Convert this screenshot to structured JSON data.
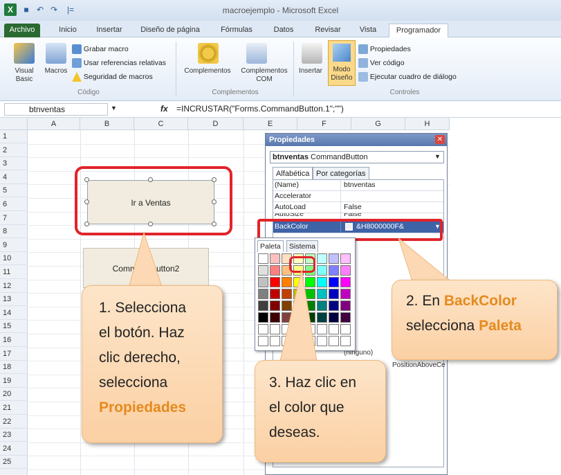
{
  "window": {
    "title": "macroejemplo - Microsoft Excel"
  },
  "quick_access": {
    "excel_logo": "X",
    "save": "■",
    "undo": "↶",
    "redo": "↷",
    "customize": "|="
  },
  "tabs": [
    "Archivo",
    "Inicio",
    "Insertar",
    "Diseño de página",
    "Fórmulas",
    "Datos",
    "Revisar",
    "Vista",
    "Programador"
  ],
  "ribbon": {
    "codigo": {
      "visual_basic": "Visual Basic",
      "macros": "Macros",
      "grabar": "Grabar macro",
      "referencias": "Usar referencias relativas",
      "seguridad": "Seguridad de macros",
      "group": "Código"
    },
    "complementos": {
      "complementos": "Complementos",
      "com": "Complementos COM",
      "group": "Complementos"
    },
    "controles": {
      "insertar": "Insertar",
      "modo_diseno": "Modo Diseño",
      "propiedades": "Propiedades",
      "ver_codigo": "Ver código",
      "ejecutar": "Ejecutar cuadro de diálogo",
      "group": "Controles"
    }
  },
  "formula_bar": {
    "name_box": "btnventas",
    "fx": "fx",
    "formula": "=INCRUSTAR(\"Forms.CommandButton.1\";\"\")"
  },
  "columns": [
    "A",
    "B",
    "C",
    "D",
    "E",
    "F",
    "G",
    "H"
  ],
  "rows": [
    "1",
    "2",
    "3",
    "4",
    "5",
    "6",
    "7",
    "8",
    "9",
    "10",
    "11",
    "12",
    "13",
    "14",
    "15",
    "16",
    "17",
    "18",
    "19",
    "20",
    "21",
    "22",
    "23",
    "24",
    "25"
  ],
  "buttons": {
    "btn1": "Ir a Ventas",
    "btn2": "CommandButton2"
  },
  "properties_window": {
    "title": "Propiedades",
    "object_name": "btnventas",
    "object_type": "CommandButton",
    "tabs": [
      "Alfabética",
      "Por categorías"
    ],
    "rows": [
      {
        "name": "(Name)",
        "value": "btnventas"
      },
      {
        "name": "Accelerator",
        "value": ""
      },
      {
        "name": "AutoLoad",
        "value": "False"
      },
      {
        "name": "AutoSize",
        "value": "False"
      },
      {
        "name": "BackColor",
        "value": "&H8000000F&"
      }
    ],
    "lower_rows": [
      {
        "name": "",
        "value": "(ninguno)"
      },
      {
        "name": "",
        "value": "PositionAboveCe"
      }
    ]
  },
  "palette": {
    "tabs": [
      "Paleta",
      "Sistema"
    ],
    "colors": [
      [
        "#ffffff",
        "#ffc0c0",
        "#ffe0c0",
        "#ffffc0",
        "#c0ffc0",
        "#c0ffff",
        "#c0c0ff",
        "#ffc0ff"
      ],
      [
        "#e0e0e0",
        "#ff8080",
        "#ffc080",
        "#ffff80",
        "#80ff80",
        "#80ffff",
        "#8080ff",
        "#ff80ff"
      ],
      [
        "#c0c0c0",
        "#ff0000",
        "#ff8000",
        "#ffff00",
        "#00ff00",
        "#00ffff",
        "#0000ff",
        "#ff00ff"
      ],
      [
        "#808080",
        "#c00000",
        "#c04000",
        "#c0c000",
        "#00c000",
        "#00c0c0",
        "#0000c0",
        "#c000c0"
      ],
      [
        "#404040",
        "#800000",
        "#804000",
        "#808000",
        "#008000",
        "#008080",
        "#000080",
        "#800080"
      ],
      [
        "#000000",
        "#400000",
        "#804040",
        "#404000",
        "#004000",
        "#004040",
        "#000040",
        "#400040"
      ],
      [
        "#ffffff",
        "#ffffff",
        "#ffffff",
        "#ffffff",
        "#ffffff",
        "#ffffff",
        "#ffffff",
        "#ffffff"
      ],
      [
        "#ffffff",
        "#ffffff",
        "#ffffff",
        "#ffffff",
        "#ffffff",
        "#ffffff",
        "#ffffff",
        "#ffffff"
      ]
    ]
  },
  "callouts": {
    "c1": {
      "line1": "1. Selecciona",
      "line2": "el botón. Haz",
      "line3": "clic derecho,",
      "line4": "selecciona",
      "highlight": "Propiedades"
    },
    "c2": {
      "prefix": "2. En ",
      "h1": "BackColor",
      "mid": "selecciona ",
      "h2": "Paleta"
    },
    "c3": {
      "line1": "3. Haz clic en",
      "line2": "el color que",
      "line3": "deseas."
    }
  },
  "colors": {
    "accent_red": "#e0242a",
    "callout_orange": "#e58a1f",
    "callout_bg": "#fcd9b4"
  }
}
